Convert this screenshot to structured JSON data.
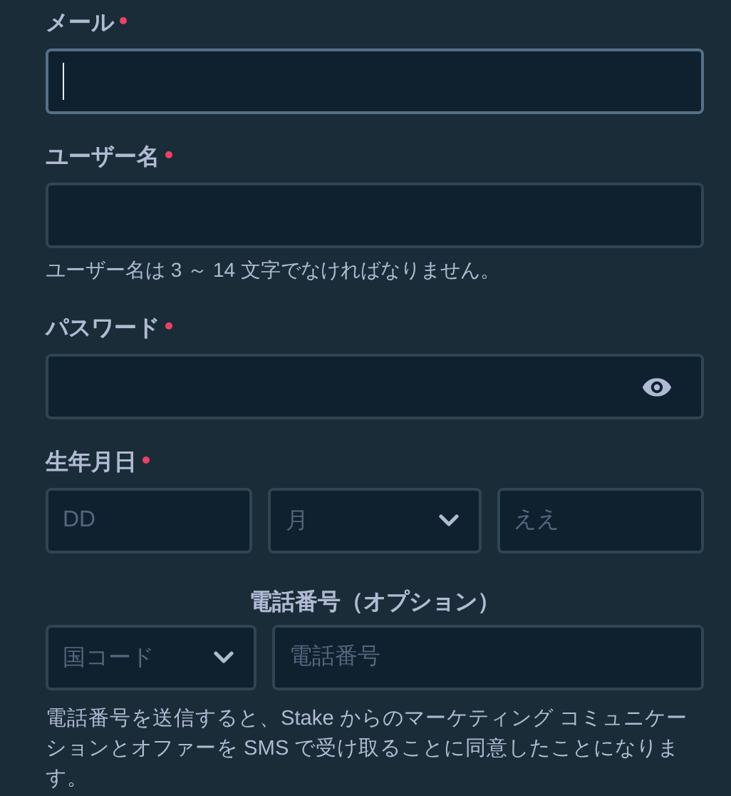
{
  "fields": [
    {
      "kind": "text",
      "label": "メール",
      "required": true,
      "focused": true
    },
    {
      "kind": "text",
      "label": "ユーザー名",
      "required": true,
      "focused": false,
      "hint": "ユーザー名は 3 ～ 14 文字でなければなりません。"
    },
    {
      "kind": "password",
      "label": "パスワード",
      "required": true,
      "focused": false
    },
    {
      "kind": "date",
      "label": "生年月日",
      "required": true,
      "day_placeholder": "DD",
      "month_placeholder": "月",
      "year_placeholder": "ええ"
    },
    {
      "kind": "phone",
      "label": "電話番号（オプション）",
      "required": false,
      "country_placeholder": "国コード",
      "number_placeholder": "電話番号",
      "notice": "電話番号を送信すると、Stake からのマーケティング コミュニケーションとオファーを SMS で受け取ることに同意したことになります。"
    }
  ]
}
